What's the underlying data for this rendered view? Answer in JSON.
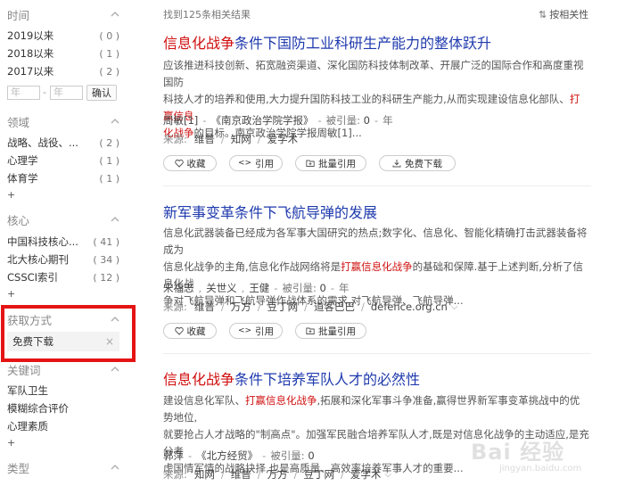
{
  "sidebar": {
    "time": {
      "title": "时间",
      "items": [
        {
          "label": "2019以来",
          "count": "( 0 )"
        },
        {
          "label": "2018以来",
          "count": "( 1 )"
        },
        {
          "label": "2017以来",
          "count": "( 2 )"
        }
      ],
      "year_from_placeholder": "年",
      "year_to_placeholder": "年",
      "dash": "-",
      "confirm_label": "确认"
    },
    "field": {
      "title": "领域",
      "items": [
        {
          "label": "战略、战役、...",
          "count": "( 2 )"
        },
        {
          "label": "心理学",
          "count": "( 1 )"
        },
        {
          "label": "体育学",
          "count": "( 1 )"
        }
      ],
      "more": "+"
    },
    "core": {
      "title": "核心",
      "items": [
        {
          "label": "中国科技核心...",
          "count": "( 41 )"
        },
        {
          "label": "北大核心期刊",
          "count": "( 34 )"
        },
        {
          "label": "CSSCI索引",
          "count": "( 12 )"
        }
      ],
      "more": "+"
    },
    "access": {
      "title": "获取方式",
      "selected": "免费下载",
      "clear": "×"
    },
    "keywords": {
      "title": "关键词",
      "items": [
        "军队卫生",
        "模糊综合评价",
        "心理素质"
      ],
      "more": "+"
    },
    "type": {
      "title": "类型"
    }
  },
  "results": {
    "count_text": "找到125条相关结果",
    "sort_label": "按相关性",
    "items": [
      {
        "title_hl": "信息化战争",
        "title_rest": "条件下国防工业科研生产能力的整体跃升",
        "abs_1": "应该推进科技创新、拓宽融资渠道、深化国防科技体制改革、开展广泛的国际合作和高度重视国防",
        "abs_2": "科技人才的培养和使用,大力提升国防科技工业的科研生产能力,从而实现建设信息化部队、",
        "abs_2_hl": "打赢信息",
        "abs_3_hl": "化战争",
        "abs_3": "的目标。南京政治学院学报周敏[1]...",
        "authors": "周敏[1]",
        "journal": "《南京政治学院学报》",
        "cite_label": "被引量:",
        "cite_count": "0",
        "year": "年",
        "source_label": "来源:",
        "sources": [
          "维普",
          "知网",
          "爱学术"
        ],
        "btn_collect": "收藏",
        "btn_cite": "引用",
        "btn_batch": "批量引用",
        "btn_download": "免费下载"
      },
      {
        "title": "新军事变革条件下飞航导弹的发展",
        "abs_1": "信息化武器装备已经成为各军事大国研究的热点;数字化、信息化、智能化精确打击武器装备将成为",
        "abs_2a": "信息化战争的主角,信息化作战网络将是",
        "abs_2_hl": "打赢信息化战争",
        "abs_2b": "的基础和保障.基于上述判断,分析了信息化战",
        "abs_3": "争对飞航导弹和飞航导弹作战体系的需求,对飞航导弹、飞航导弹...",
        "authors": [
          "宋福志",
          "关世义",
          "王健"
        ],
        "cite_label": "被引量:",
        "cite_count": "0",
        "year": "年",
        "source_label": "来源:",
        "sources": [
          "维普",
          "万方",
          "豆丁网",
          "道客巴巴",
          "defence.org.cn"
        ],
        "btn_collect": "收藏",
        "btn_cite": "引用",
        "btn_batch": "批量引用"
      },
      {
        "title_hl": "信息化战争",
        "title_rest": "条件下培养军队人才的必然性",
        "abs_1a": "建设信息化军队、",
        "abs_1_hl": "打赢信息化战争",
        "abs_1b": ",拓展和深化军事斗争准备,赢得世界新军事变革挑战中的优势地位,",
        "abs_2": "就要抢占人才战略的\"制高点\"。加强军民融合培养军队人才,既是对信息化战争的主动适应,是充分考",
        "abs_3": "虑国情军情的战略抉择,也是高质量、高效率培养军事人才的重要...",
        "authors": "郭萍",
        "journal": "《北方经贸》",
        "cite_label": "被引量:",
        "cite_count": "0",
        "source_label": "来源:",
        "sources": [
          "知网",
          "维普",
          "万方",
          "豆丁网",
          "爱学术"
        ]
      }
    ]
  },
  "watermark": {
    "text": "Bai 经验",
    "sub": "jingyan.baidu.com"
  }
}
